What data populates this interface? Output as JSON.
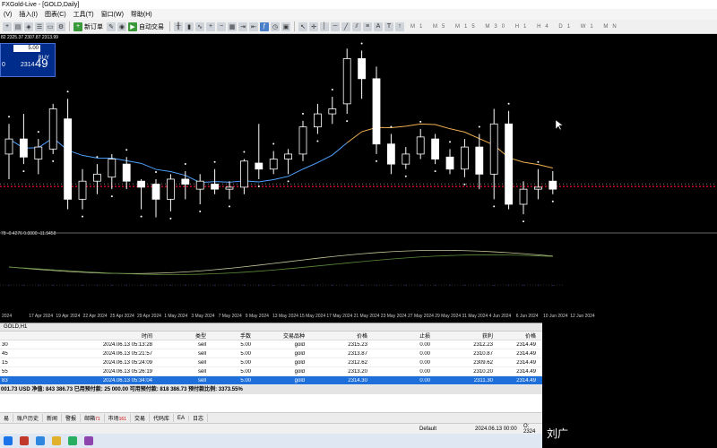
{
  "window": {
    "title": "FXGold-Live - [GOLD,Daily]"
  },
  "menu": [
    "(V)",
    "插入(I)",
    "图表(C)",
    "工具(T)",
    "窗口(W)",
    "帮助(H)"
  ],
  "toolbar": {
    "new_order_label": "新订单",
    "auto_trade_label": "自动交易",
    "timeframes": [
      "M1",
      "M5",
      "M15",
      "M30",
      "H1",
      "H4",
      "D1",
      "W1",
      "MN"
    ]
  },
  "chart": {
    "ohlc_text": "82 2325.37 2307.87 2313.99",
    "oscillator_label": "78 -0.4276 0.0000 -11.9458",
    "one_click": {
      "lots": "5.00",
      "left_price": "0",
      "buy_label": "BUY",
      "buy_price_small": "2314",
      "buy_price_big": "49"
    },
    "colors": {
      "up_candle": "#000000",
      "down_candle": "#ffffff",
      "candle_stroke": "#ffffff",
      "ma_blue": "#4fa0ff",
      "ma_orange": "#f0b050",
      "psar": "#ffffff",
      "osc_line": "#c8c89a",
      "osc_signal": "#5a8a3a",
      "level_red": "#c8102e"
    },
    "date_labels": [
      "2024",
      "17 Apr 2024",
      "19 Apr 2024",
      "22 Apr 2024",
      "25 Apr 2024",
      "29 Apr 2024",
      "1 May 2024",
      "3 May 2024",
      "7 May 2024",
      "9 May 2024",
      "13 May 2024",
      "15 May 2024",
      "17 May 2024",
      "21 May 2024",
      "23 May 2024",
      "27 May 2024",
      "29 May 2024",
      "31 May 2024",
      "4 Jun 2024",
      "6 Jun 2024",
      "10 Jun 2024",
      "12 Jun 2024"
    ]
  },
  "chart_data": {
    "type": "candlestick",
    "symbol": "GOLD",
    "timeframe": "Daily",
    "candles": [
      {
        "open": 2345,
        "high": 2375,
        "low": 2320,
        "close": 2360
      },
      {
        "open": 2360,
        "high": 2385,
        "low": 2335,
        "close": 2342
      },
      {
        "open": 2340,
        "high": 2360,
        "low": 2325,
        "close": 2352
      },
      {
        "open": 2350,
        "high": 2395,
        "low": 2345,
        "close": 2390
      },
      {
        "open": 2380,
        "high": 2400,
        "low": 2290,
        "close": 2300
      },
      {
        "open": 2300,
        "high": 2330,
        "low": 2290,
        "close": 2318
      },
      {
        "open": 2318,
        "high": 2335,
        "low": 2305,
        "close": 2325
      },
      {
        "open": 2322,
        "high": 2345,
        "low": 2310,
        "close": 2340
      },
      {
        "open": 2335,
        "high": 2342,
        "low": 2310,
        "close": 2318
      },
      {
        "open": 2318,
        "high": 2320,
        "low": 2290,
        "close": 2312
      },
      {
        "open": 2315,
        "high": 2320,
        "low": 2282,
        "close": 2300
      },
      {
        "open": 2300,
        "high": 2325,
        "low": 2288,
        "close": 2320
      },
      {
        "open": 2320,
        "high": 2328,
        "low": 2300,
        "close": 2315
      },
      {
        "open": 2310,
        "high": 2325,
        "low": 2295,
        "close": 2318
      },
      {
        "open": 2315,
        "high": 2330,
        "low": 2305,
        "close": 2310
      },
      {
        "open": 2310,
        "high": 2318,
        "low": 2300,
        "close": 2312
      },
      {
        "open": 2312,
        "high": 2340,
        "low": 2305,
        "close": 2338
      },
      {
        "open": 2336,
        "high": 2375,
        "low": 2320,
        "close": 2330
      },
      {
        "open": 2330,
        "high": 2348,
        "low": 2325,
        "close": 2340
      },
      {
        "open": 2340,
        "high": 2350,
        "low": 2325,
        "close": 2345
      },
      {
        "open": 2345,
        "high": 2378,
        "low": 2338,
        "close": 2372
      },
      {
        "open": 2372,
        "high": 2395,
        "low": 2365,
        "close": 2385
      },
      {
        "open": 2385,
        "high": 2402,
        "low": 2375,
        "close": 2390
      },
      {
        "open": 2395,
        "high": 2450,
        "low": 2385,
        "close": 2440
      },
      {
        "open": 2440,
        "high": 2448,
        "low": 2400,
        "close": 2420
      },
      {
        "open": 2420,
        "high": 2432,
        "low": 2345,
        "close": 2355
      },
      {
        "open": 2355,
        "high": 2365,
        "low": 2325,
        "close": 2335
      },
      {
        "open": 2335,
        "high": 2352,
        "low": 2330,
        "close": 2345
      },
      {
        "open": 2345,
        "high": 2370,
        "low": 2340,
        "close": 2362
      },
      {
        "open": 2360,
        "high": 2365,
        "low": 2335,
        "close": 2340
      },
      {
        "open": 2342,
        "high": 2350,
        "low": 2325,
        "close": 2330
      },
      {
        "open": 2330,
        "high": 2360,
        "low": 2322,
        "close": 2352
      },
      {
        "open": 2352,
        "high": 2365,
        "low": 2310,
        "close": 2325
      },
      {
        "open": 2325,
        "high": 2390,
        "low": 2300,
        "close": 2375
      },
      {
        "open": 2375,
        "high": 2388,
        "low": 2290,
        "close": 2295
      },
      {
        "open": 2295,
        "high": 2318,
        "low": 2285,
        "close": 2310
      },
      {
        "open": 2310,
        "high": 2330,
        "low": 2300,
        "close": 2312
      },
      {
        "open": 2318,
        "high": 2328,
        "low": 2305,
        "close": 2310
      }
    ],
    "current_price": 2314.49
  },
  "terminal": {
    "title": "GOLD,H1",
    "columns": [
      "",
      "时间",
      "类型",
      "手数",
      "交易品种",
      "价格",
      "止损",
      "获利",
      "价格"
    ],
    "rows": [
      {
        "id": "30",
        "time": "2024.06.13 05:13:28",
        "type": "sell",
        "lots": "5.00",
        "symbol": "gold",
        "price": "2315.23",
        "sl": "0.00",
        "tp": "2312.23",
        "cur": "2314.49"
      },
      {
        "id": "45",
        "time": "2024.06.13 05:21:57",
        "type": "sell",
        "lots": "5.00",
        "symbol": "gold",
        "price": "2313.87",
        "sl": "0.00",
        "tp": "2310.87",
        "cur": "2314.49"
      },
      {
        "id": "15",
        "time": "2024.06.13 05:24:09",
        "type": "sell",
        "lots": "5.00",
        "symbol": "gold",
        "price": "2312.62",
        "sl": "0.00",
        "tp": "2309.62",
        "cur": "2314.49"
      },
      {
        "id": "55",
        "time": "2024.06.13 05:26:19",
        "type": "sell",
        "lots": "5.00",
        "symbol": "gold",
        "price": "2313.20",
        "sl": "0.00",
        "tp": "2310.20",
        "cur": "2314.49"
      },
      {
        "id": "83",
        "time": "2024.06.13 05:34:04",
        "type": "sell",
        "lots": "5.00",
        "symbol": "gold",
        "price": "2314.30",
        "sl": "0.00",
        "tp": "2311.30",
        "cur": "2314.49"
      }
    ],
    "balance_text": "001.73 USD  净值: 843 386.73  已用预付款: 25 000.00  可用预付款: 818 386.73  预付款比例: 3373.55%"
  },
  "tabs": [
    {
      "label": "易"
    },
    {
      "label": "账户历史"
    },
    {
      "label": "新闻"
    },
    {
      "label": "警报"
    },
    {
      "label": "邮箱",
      "badge": "71"
    },
    {
      "label": "市场",
      "badge": "161"
    },
    {
      "label": "交易"
    },
    {
      "label": "代码库"
    },
    {
      "label": "EA"
    },
    {
      "label": "日志"
    }
  ],
  "status": {
    "profile": "Default",
    "datetime": "2024.06.13 00:00",
    "ohlc": "O: 2324"
  },
  "video": {
    "name": "刘广"
  }
}
